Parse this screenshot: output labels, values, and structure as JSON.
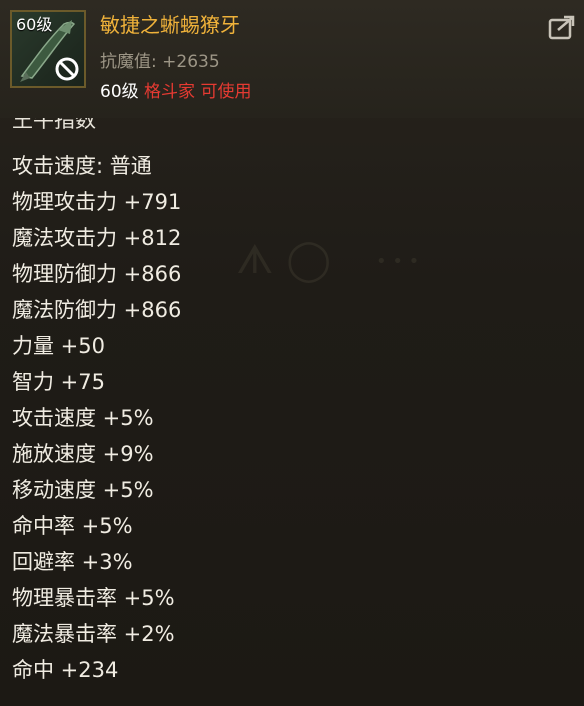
{
  "item": {
    "level_badge": "60级",
    "name": "敏捷之蜥蜴獠牙",
    "resist": "抗魔值: +2635",
    "req_level": "60级",
    "req_class": "格斗家 可使用",
    "icons": {
      "item": "fang-weapon-icon",
      "restriction": "forbidden-icon",
      "share": "share-icon"
    }
  },
  "cut_line": "王牛指数",
  "stats": [
    "攻击速度: 普通",
    "物理攻击力 +791",
    "魔法攻击力 +812",
    "物理防御力 +866",
    "魔法防御力 +866",
    "力量 +50",
    "智力 +75",
    "攻击速度 +5%",
    "施放速度 +9%",
    "移动速度 +5%",
    "命中率 +5%",
    "回避率 +3%",
    "物理暴击率 +5%",
    "魔法暴击率 +2%",
    "命中 +234"
  ],
  "colors": {
    "name": "#f0b23a",
    "resist": "#9d9686",
    "class_req": "#e63a32",
    "stat_text": "#f0ece2"
  }
}
